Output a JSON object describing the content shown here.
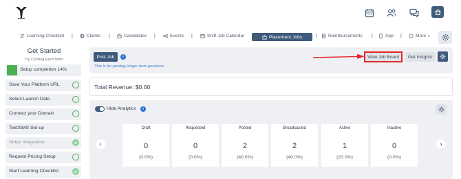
{
  "nav": {
    "items": [
      {
        "label": "Learning Checklist"
      },
      {
        "label": "Clients"
      },
      {
        "label": "Candidates"
      },
      {
        "label": "Events"
      },
      {
        "label": "Shift Job Calendar"
      },
      {
        "label": "Placement Jobs"
      },
      {
        "label": "Reimbursements"
      },
      {
        "label": "App"
      },
      {
        "label": "More"
      }
    ]
  },
  "sidebar": {
    "title": "Get Started",
    "subtitle": "Try Clicking Each Item!",
    "completion_label": "Setup completion 14%",
    "completion_percent": 14,
    "steps": [
      {
        "label": "Save Your Platform URL",
        "done": false
      },
      {
        "label": "Select Launch Date",
        "done": false
      },
      {
        "label": "Connect your Domain",
        "done": false
      },
      {
        "label": "Text/SMS Set-up",
        "done": false
      },
      {
        "label": "Stripe Integration",
        "done": true
      },
      {
        "label": "Request Pricing Setup",
        "done": false
      },
      {
        "label": "Start Learning Checklist",
        "done": true
      }
    ]
  },
  "jobs": {
    "post_job_label": "Post Job",
    "hint": "This is for posting longer term positions",
    "view_job_board_label": "View Job Board",
    "get_insights_label": "Get Insights"
  },
  "revenue": {
    "label": "Total Revenue: $0.00"
  },
  "analytics": {
    "toggle_label": "Hide Analytics",
    "stats": [
      {
        "header": "Draft",
        "value": "0",
        "percent": "(0.0%)"
      },
      {
        "header": "Requested",
        "value": "0",
        "percent": "(0.0%)"
      },
      {
        "header": "Posted",
        "value": "2",
        "percent": "(40.0%)"
      },
      {
        "header": "Broadcasted",
        "value": "2",
        "percent": "(40.0%)"
      },
      {
        "header": "Active",
        "value": "1",
        "percent": "(20.0%)"
      },
      {
        "header": "Inactive",
        "value": "0",
        "percent": "(0.0%)"
      }
    ]
  },
  "colors": {
    "brand": "#3f5a7a",
    "success": "#4caf50",
    "highlight": "#e0262b",
    "info": "#2f6fd6"
  }
}
